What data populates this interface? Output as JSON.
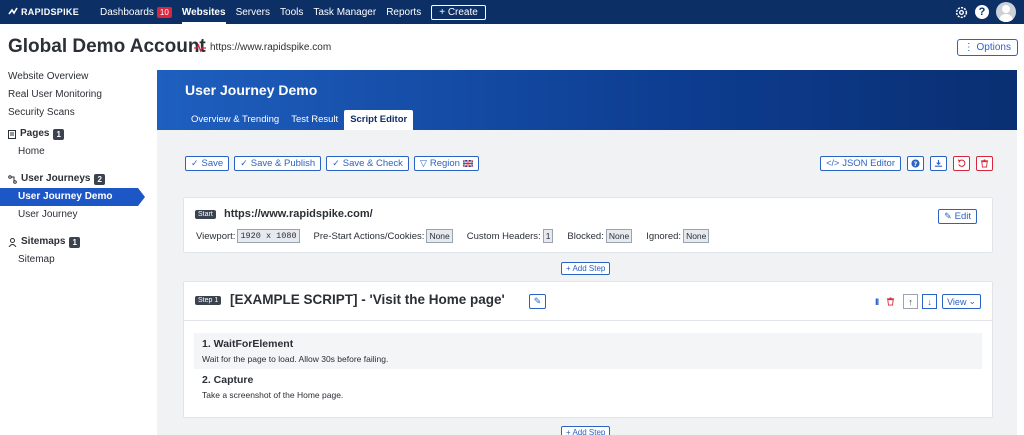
{
  "topnav": {
    "logo": "RAPIDSPIKE",
    "items": [
      {
        "label": "Dashboards",
        "badge": "10"
      },
      {
        "label": "Websites",
        "active": true
      },
      {
        "label": "Servers"
      },
      {
        "label": "Tools"
      },
      {
        "label": "Task Manager"
      },
      {
        "label": "Reports"
      }
    ],
    "create_label": "+ Create",
    "help_label": "?"
  },
  "header": {
    "title": "Global Demo Account",
    "url": "https://www.rapidspike.com",
    "options_label": "⋮ Options"
  },
  "sidebar": {
    "links": [
      "Website Overview",
      "Real User Monitoring",
      "Security Scans"
    ],
    "pages": {
      "label": "Pages",
      "count": "1",
      "items": [
        "Home"
      ]
    },
    "journeys": {
      "label": "User Journeys",
      "count": "2",
      "items": [
        "User Journey Demo",
        "User Journey"
      ]
    },
    "sitemaps": {
      "label": "Sitemaps",
      "count": "1",
      "items": [
        "Sitemap"
      ]
    }
  },
  "main": {
    "title": "User Journey Demo",
    "tabs": [
      "Overview & Trending",
      "Test Result",
      "Script Editor"
    ],
    "active_tab": "Script Editor",
    "toolbar": {
      "save": "Save",
      "save_publish": "Save & Publish",
      "save_check": "Save & Check",
      "region": "Region",
      "json_editor": "JSON Editor"
    },
    "start": {
      "tag": "Start",
      "url": "https://www.rapidspike.com/",
      "edit_label": "Edit",
      "viewport_label": "Viewport:",
      "viewport_value": "1920 x 1080",
      "prestart_label": "Pre-Start Actions/Cookies:",
      "prestart_value": "None",
      "headers_label": "Custom Headers:",
      "headers_value": "1",
      "blocked_label": "Blocked:",
      "blocked_value": "None",
      "ignored_label": "Ignored:",
      "ignored_value": "None"
    },
    "add_step_label": "+ Add Step",
    "step": {
      "tag": "Step 1",
      "title": "[EXAMPLE SCRIPT] - 'Visit the Home page'",
      "view_label": "View",
      "actions": [
        {
          "title": "1. WaitForElement",
          "desc": "Wait for the page to load. Allow 30s before failing."
        },
        {
          "title": "2. Capture",
          "desc": "Take a screenshot of the Home page."
        }
      ]
    }
  },
  "colors": {
    "nav_bg": "#0c2f66",
    "accent": "#2a63c4",
    "danger": "#d7263d",
    "active_sidebar": "#1d57c6"
  }
}
